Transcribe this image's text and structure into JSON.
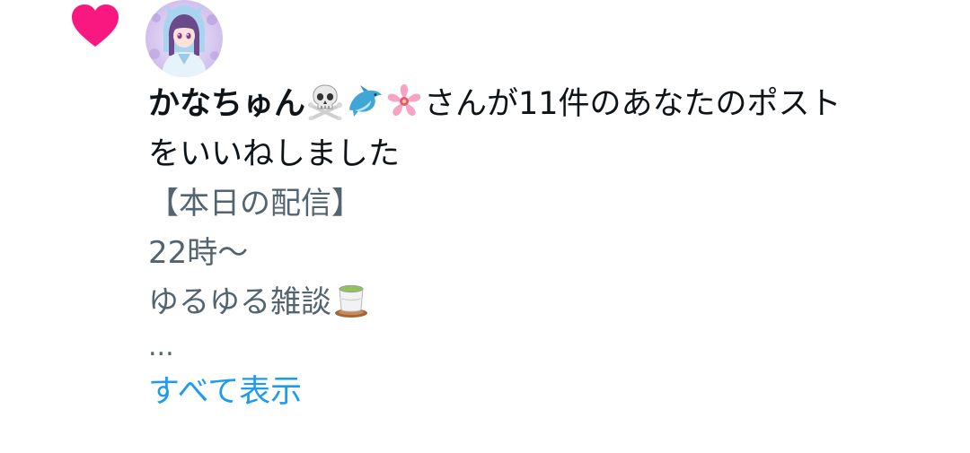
{
  "notification": {
    "type_icon": "heart-icon",
    "accent_color": "#f91880",
    "avatar": "user-avatar",
    "actor": {
      "display_name": "かなちゅん",
      "name_emojis": [
        "skull-crossbones-emoji",
        "dolphin-emoji",
        "cherry-blossom-emoji"
      ]
    },
    "headline_suffix_line1": "さんが11件のあなたのポスト",
    "headline_suffix_line2": "をいいねしました",
    "post_preview": {
      "line1": "【本日の配信】",
      "line2": "22時〜",
      "line3": "ゆるゆる雑談",
      "line3_emoji": "green-tea-emoji",
      "ellipsis": "..."
    },
    "show_more_label": "すべて表示",
    "link_color": "#1d9bf0",
    "secondary_text_color": "#536471"
  }
}
